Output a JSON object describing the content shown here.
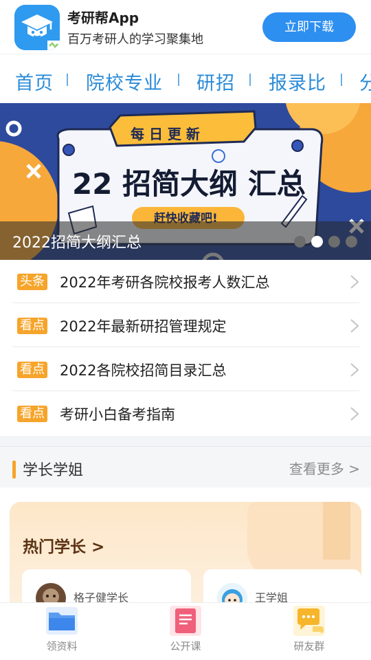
{
  "header": {
    "app_name": "考研帮App",
    "slogan": "百万考研人的学习聚集地",
    "download_label": "立即下载"
  },
  "nav": {
    "items": [
      "首页",
      "院校专业",
      "研招",
      "报录比",
      "分"
    ]
  },
  "banner": {
    "caption": "2022招简大纲汇总",
    "art": {
      "ribbon_text": "每 日 更 新",
      "headline": "22  招简大纲  汇总",
      "button_text": "赶快收藏吧!"
    },
    "slide_count": 4,
    "active_slide": 2
  },
  "news": {
    "items": [
      {
        "tag": "头条",
        "title": "2022年考研各院校报考人数汇总"
      },
      {
        "tag": "看点",
        "title": "2022年最新研招管理规定"
      },
      {
        "tag": "看点",
        "title": "2022各院校招简目录汇总"
      },
      {
        "tag": "看点",
        "title": "考研小白备考指南"
      }
    ]
  },
  "seniors": {
    "section_title": "学长学姐",
    "more_label": "查看更多 >",
    "card_heading": "热门学长 >",
    "people": [
      {
        "name": "格子健学长"
      },
      {
        "name": "王学姐"
      }
    ]
  },
  "tabbar": {
    "items": [
      {
        "label": "领资料",
        "icon": "folder-icon"
      },
      {
        "label": "公开课",
        "icon": "notebook-icon"
      },
      {
        "label": "研友群",
        "icon": "chat-icon"
      }
    ]
  },
  "colors": {
    "brand_blue": "#2d8ff0",
    "nav_blue": "#2a8bd8",
    "tag_orange": "#f6a42a",
    "banner_navy": "#2e4a9c"
  }
}
